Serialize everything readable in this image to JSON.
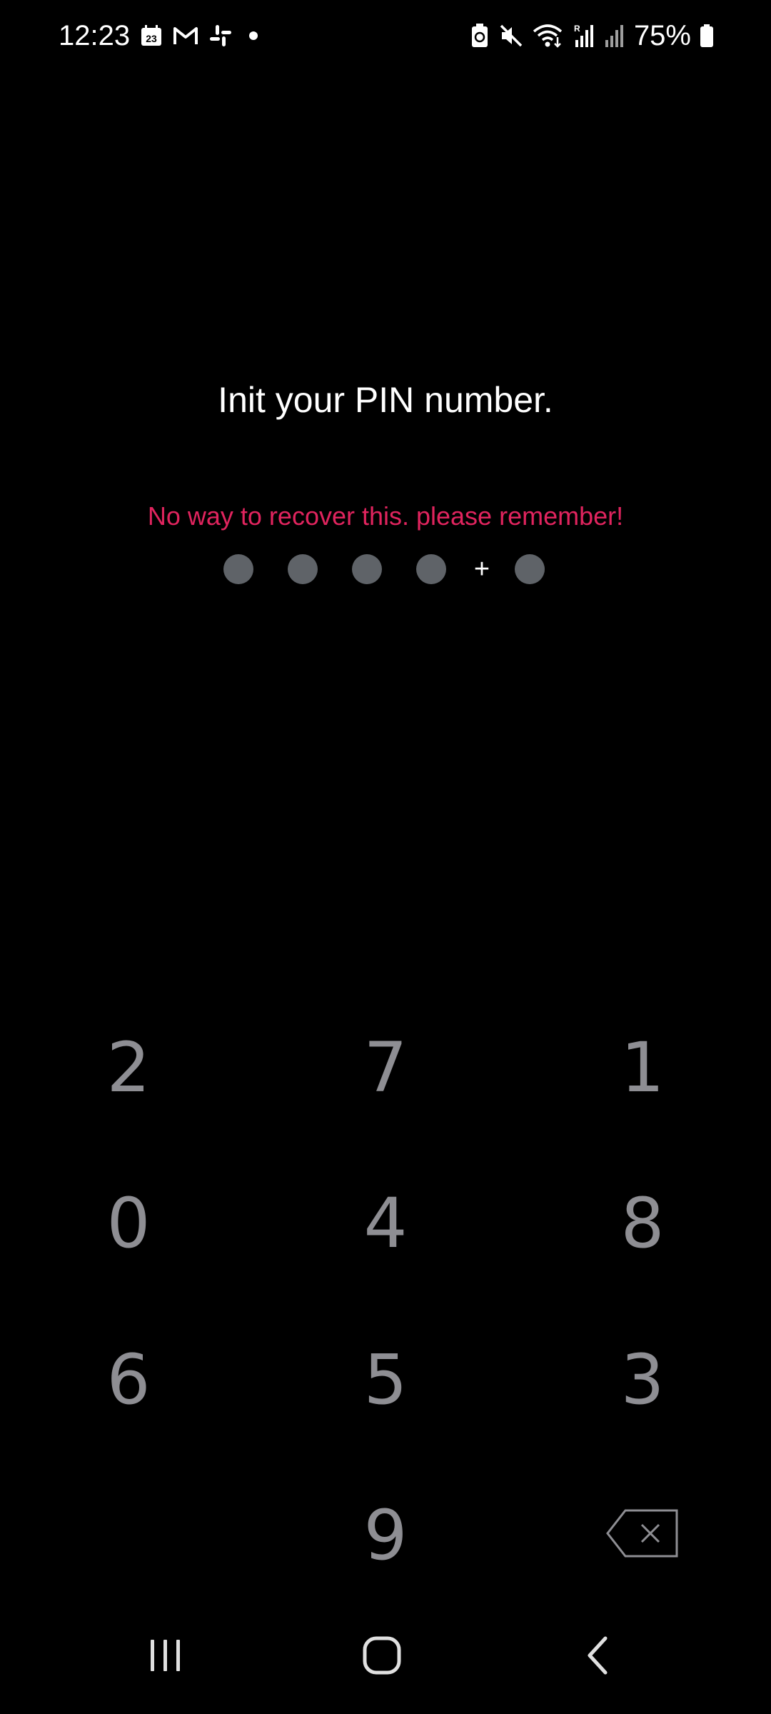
{
  "status_bar": {
    "time": "12:23",
    "calendar_day": "23",
    "battery_percent": "75%"
  },
  "screen": {
    "title": "Init your PIN number.",
    "warning": "No way to recover this. please remember!",
    "warning_color": "#e0245e",
    "pin_separator": "+",
    "pin_slots": 5
  },
  "keypad": {
    "row1": [
      "2",
      "7",
      "1"
    ],
    "row2": [
      "0",
      "4",
      "8"
    ],
    "row3": [
      "6",
      "5",
      "3"
    ],
    "row4": [
      "9"
    ],
    "backspace_icon": "backspace-icon"
  },
  "nav_bar": {
    "icons": [
      "recent-apps-icon",
      "home-icon",
      "back-icon"
    ]
  },
  "colors": {
    "background": "#000000",
    "pin_dot": "#5f6368",
    "key_text": "#8e8e93",
    "text_primary": "#ffffff"
  }
}
